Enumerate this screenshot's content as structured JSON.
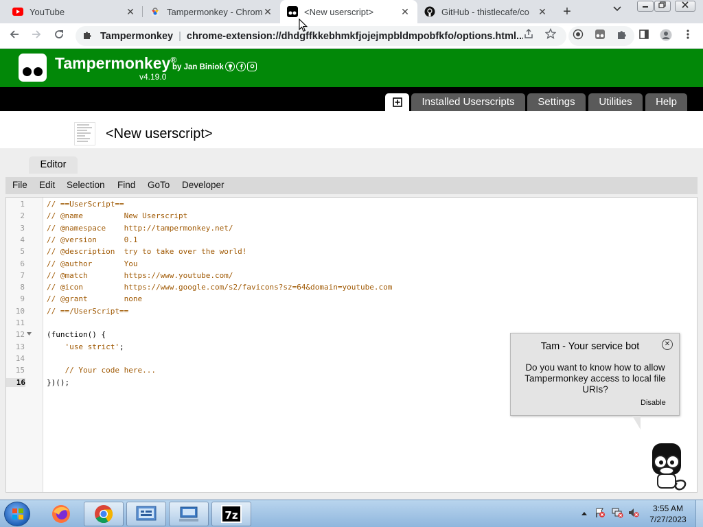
{
  "browser": {
    "tabs": [
      {
        "title": "YouTube",
        "icon": "youtube-icon",
        "active": false
      },
      {
        "title": "Tampermonkey - Chrom",
        "icon": "chrome-web-store-icon",
        "active": false
      },
      {
        "title": "<New userscript>",
        "icon": "tampermonkey-icon",
        "active": true
      },
      {
        "title": "GitHub - thistlecafe/co",
        "icon": "github-icon",
        "active": false
      }
    ],
    "close_glyph": "✕",
    "new_tab_glyph": "+",
    "omnibox": {
      "site": "Tampermonkey",
      "separator": "|",
      "url": "chrome-extension://dhdgffkkebhmkfjojejmpbldmpobfkfo/options.html..."
    }
  },
  "header": {
    "app_name": "Tampermonkey",
    "registered": "®",
    "author": "by Jan Biniok",
    "version": "v4.19.0",
    "brand_color": "#028808"
  },
  "nav": {
    "tabs": [
      "Installed Userscripts",
      "Settings",
      "Utilities",
      "Help"
    ],
    "new_script_glyph": "⊞"
  },
  "script": {
    "title": "<New userscript>"
  },
  "editor": {
    "tab_label": "Editor",
    "menu": [
      "File",
      "Edit",
      "Selection",
      "Find",
      "GoTo",
      "Developer"
    ],
    "current_line": 16,
    "lines": [
      "// ==UserScript==",
      "// @name         New Userscript",
      "// @namespace    http://tampermonkey.net/",
      "// @version      0.1",
      "// @description  try to take over the world!",
      "// @author       You",
      "// @match        https://www.youtube.com/",
      "// @icon         https://www.google.com/s2/favicons?sz=64&domain=youtube.com",
      "// @grant        none",
      "// ==/UserScript==",
      "",
      "(function() {",
      "    'use strict';",
      "",
      "    // Your code here...",
      "})();"
    ]
  },
  "bot": {
    "title": "Tam - Your service bot",
    "message": "Do you want to know how to allow Tampermonkey access to local file URIs?",
    "disable_label": "Disable",
    "close_glyph": "✕"
  },
  "taskbar": {
    "apps": [
      "firefox",
      "chrome",
      "control-panel",
      "remote-desktop",
      "7-zip"
    ],
    "seven_zip_label": "7z",
    "time": "3:55 AM",
    "date": "7/27/2023"
  }
}
